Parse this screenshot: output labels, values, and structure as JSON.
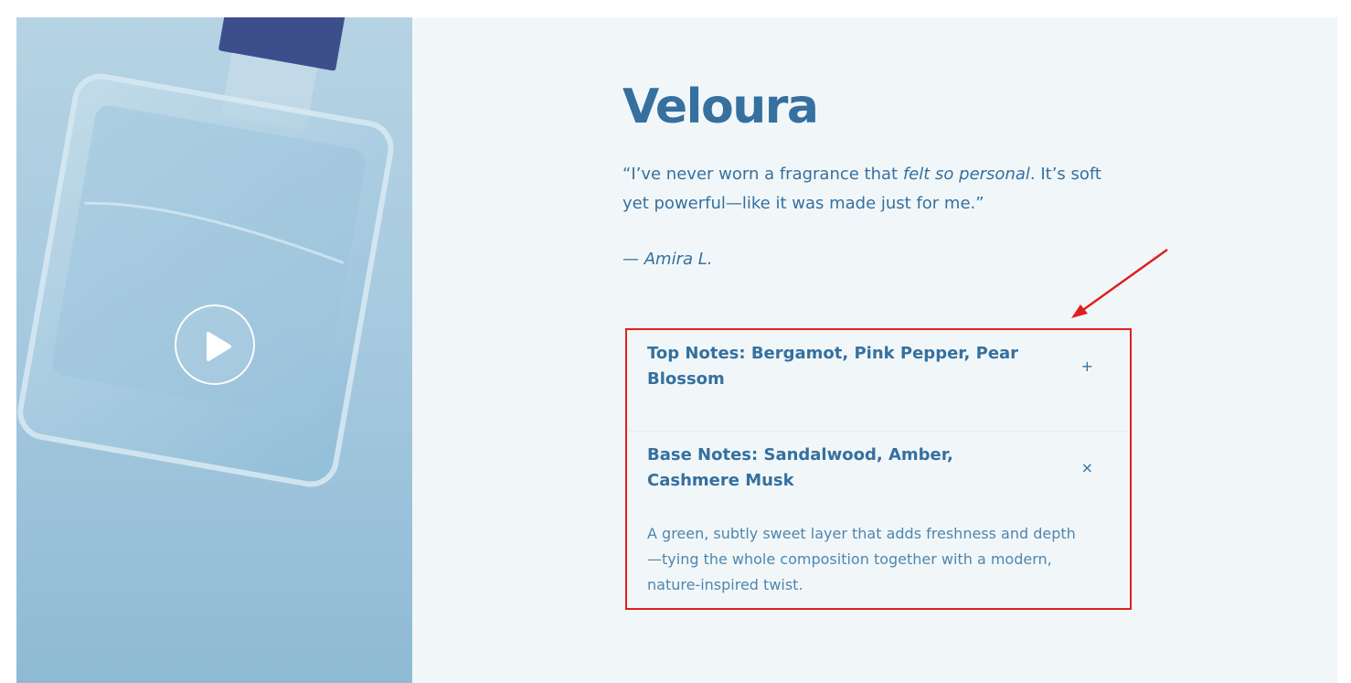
{
  "product": {
    "name": "Veloura",
    "quote_part1": "“I’ve never worn a fragrance that ",
    "quote_emphasis": "felt so personal",
    "quote_part2": ". It’s soft yet powerful—like it was made just for me.”",
    "author": "— Amira L."
  },
  "media": {
    "play_icon": "play-icon",
    "image": "perfume-bottle-photo"
  },
  "accordion": {
    "items": [
      {
        "title": "Top Notes: Bergamot, Pink Pepper, Pear Blossom",
        "toggle": "+",
        "expanded": false
      },
      {
        "title": "Base Notes: Sandalwood, Amber, Cashmere Musk",
        "toggle": "×",
        "expanded": true,
        "body": "A green, subtly sweet layer that adds freshness and depth—tying the whole composition together with a modern, nature-inspired twist."
      }
    ]
  },
  "annotation": {
    "highlight_color": "#e0201f"
  },
  "colors": {
    "accent": "#35709f",
    "panel_bg": "#f1f7f9"
  }
}
